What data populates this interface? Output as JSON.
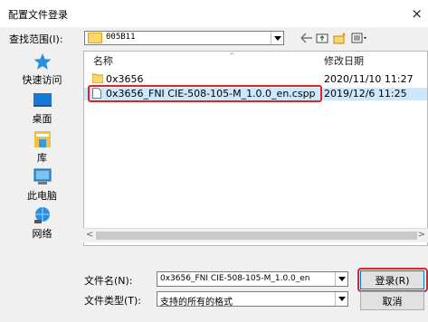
{
  "window": {
    "title": "配置文件登录",
    "close_glyph": "×"
  },
  "lookin": {
    "label": "查找范围(I):",
    "value": "005B11"
  },
  "places": [
    {
      "label": "快速访问",
      "icon": "star-icon"
    },
    {
      "label": "桌面",
      "icon": "desktop-icon"
    },
    {
      "label": "库",
      "icon": "library-icon"
    },
    {
      "label": "此电脑",
      "icon": "computer-icon"
    },
    {
      "label": "网络",
      "icon": "network-icon"
    }
  ],
  "columns": {
    "name": "名称",
    "date": "修改日期"
  },
  "files": [
    {
      "name": "0x3656",
      "date": "2020/11/10 11:27",
      "type": "folder"
    },
    {
      "name": "0x3656_FNI CIE-508-105-M_1.0.0_en.cspp",
      "date": "2019/12/6 11:25",
      "type": "file"
    }
  ],
  "filename": {
    "label": "文件名(N):",
    "value": "0x3656_FNI CIE-508-105-M_1.0.0_en"
  },
  "filetype": {
    "label": "文件类型(T):",
    "value": "支持的所有的格式"
  },
  "buttons": {
    "login": "登录(R)",
    "cancel": "取消"
  },
  "colors": {
    "selection": "#cce8ff",
    "highlight_box": "#e02424",
    "folder": "#ffd767",
    "accent": "#0078d7"
  }
}
